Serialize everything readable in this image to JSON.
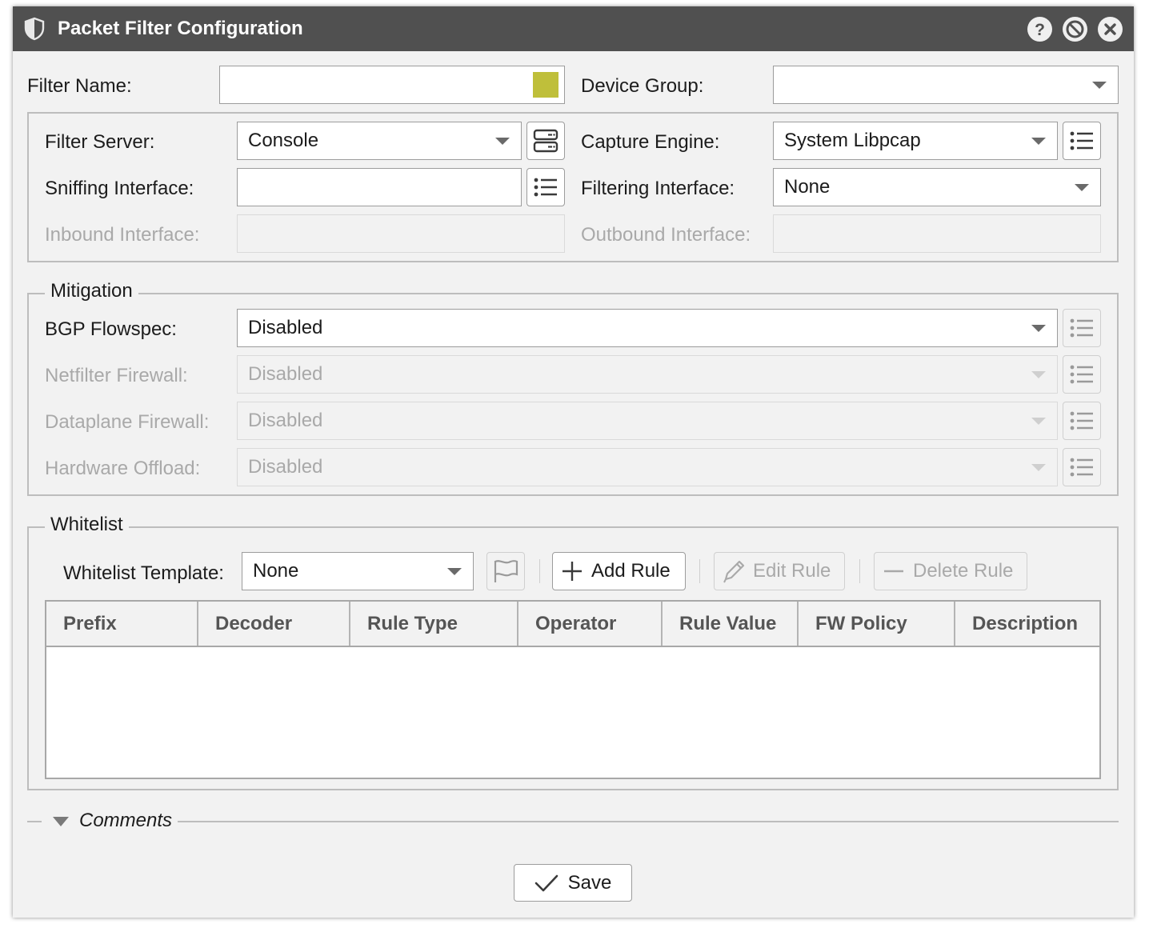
{
  "window": {
    "title": "Packet Filter Configuration"
  },
  "header": {
    "filter_name_label": "Filter Name:",
    "filter_name_value": "",
    "filter_color": "#bfbf3a",
    "device_group_label": "Device Group:",
    "device_group_value": ""
  },
  "server": {
    "filter_server_label": "Filter Server:",
    "filter_server_value": "Console",
    "capture_engine_label": "Capture Engine:",
    "capture_engine_value": "System Libpcap",
    "sniffing_interface_label": "Sniffing Interface:",
    "sniffing_interface_value": "",
    "filtering_interface_label": "Filtering Interface:",
    "filtering_interface_value": "None",
    "inbound_interface_label": "Inbound Interface:",
    "inbound_interface_value": "",
    "outbound_interface_label": "Outbound Interface:",
    "outbound_interface_value": ""
  },
  "mitigation": {
    "legend": "Mitigation",
    "rows": [
      {
        "label": "BGP Flowspec:",
        "value": "Disabled",
        "enabled": true
      },
      {
        "label": "Netfilter Firewall:",
        "value": "Disabled",
        "enabled": false
      },
      {
        "label": "Dataplane Firewall:",
        "value": "Disabled",
        "enabled": false
      },
      {
        "label": "Hardware Offload:",
        "value": "Disabled",
        "enabled": false
      }
    ]
  },
  "whitelist": {
    "legend": "Whitelist",
    "template_label": "Whitelist Template:",
    "template_value": "None",
    "add_rule": "Add Rule",
    "edit_rule": "Edit Rule",
    "delete_rule": "Delete Rule",
    "columns": [
      "Prefix",
      "Decoder",
      "Rule Type",
      "Operator",
      "Rule Value",
      "FW Policy",
      "Description"
    ],
    "rows": []
  },
  "comments": {
    "label": "Comments"
  },
  "footer": {
    "save_label": "Save"
  }
}
